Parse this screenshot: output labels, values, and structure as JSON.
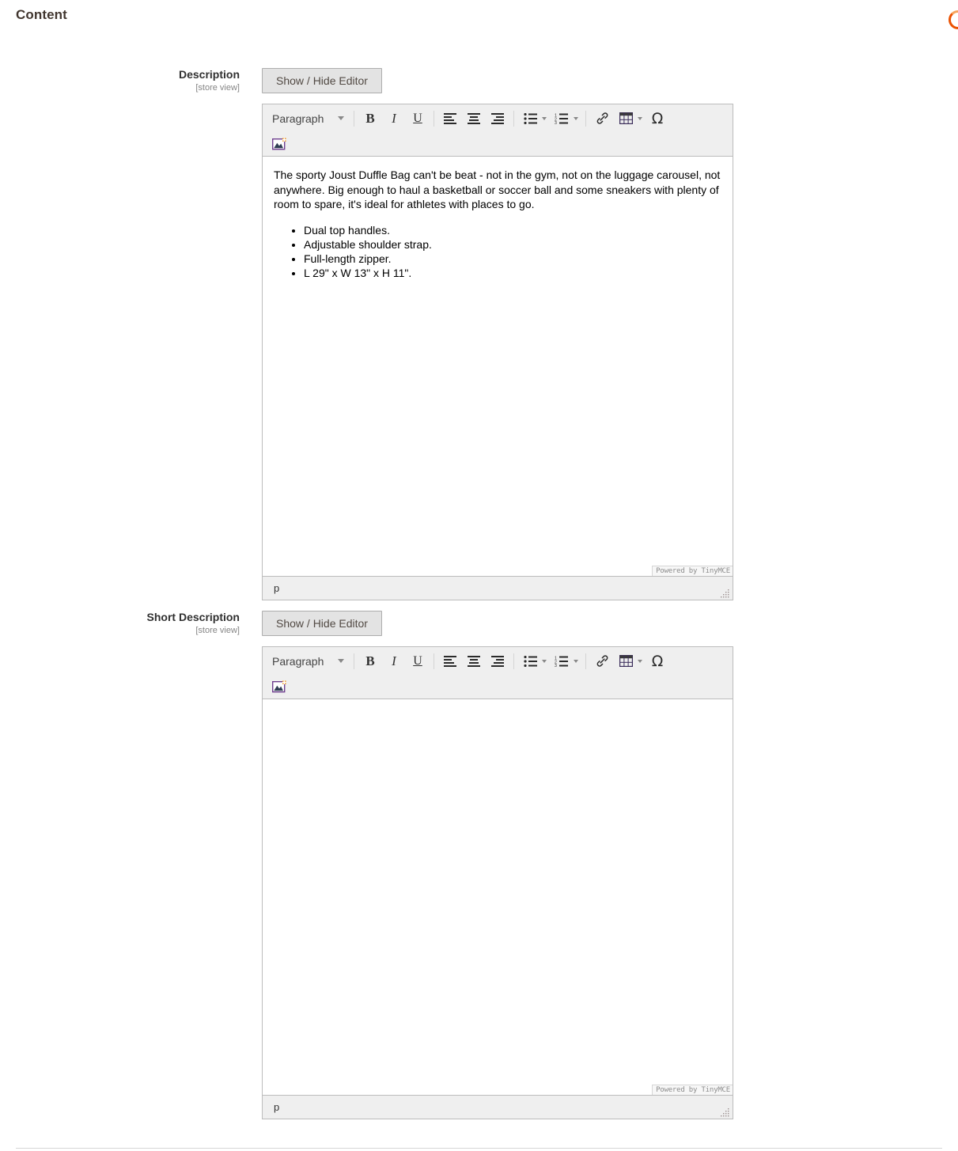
{
  "section": {
    "title": "Content"
  },
  "loader": {
    "name": "page-loading-spinner"
  },
  "fields": [
    {
      "label": "Description",
      "scope": "[store view]",
      "toggle_label": "Show / Hide Editor",
      "editor": {
        "style_select": "Paragraph",
        "tiny_badge": "Powered by TinyMCE",
        "status_path": "p",
        "content": {
          "paragraph": "The sporty Joust Duffle Bag can't be beat - not in the gym, not on the luggage carousel, not anywhere. Big enough to haul a basketball or soccer ball and some sneakers with plenty of room to spare, it's ideal for athletes with places to go.",
          "bullets": [
            "Dual top handles.",
            "Adjustable shoulder strap.",
            "Full-length zipper.",
            "L 29\" x W 13\" x H 11\"."
          ]
        }
      }
    },
    {
      "label": "Short Description",
      "scope": "[store view]",
      "toggle_label": "Show / Hide Editor",
      "editor": {
        "style_select": "Paragraph",
        "tiny_badge": "Powered by TinyMCE",
        "status_path": "p",
        "content": {
          "paragraph": "",
          "bullets": []
        }
      }
    }
  ],
  "toolbar_icons": [
    "bold-icon",
    "italic-icon",
    "underline-icon",
    "align-left-icon",
    "align-center-icon",
    "align-right-icon",
    "bullet-list-icon",
    "numbered-list-icon",
    "insert-link-icon",
    "insert-table-icon",
    "special-character-icon",
    "insert-image-icon"
  ],
  "colors": {
    "heading": "#41362f",
    "toolbar_bg": "#efefef",
    "border": "#bcbcbc",
    "button_bg": "#e3e3e3",
    "scope_text": "#858585",
    "accent_orange": "#eb5202",
    "accent_blue": "#007bdb"
  }
}
